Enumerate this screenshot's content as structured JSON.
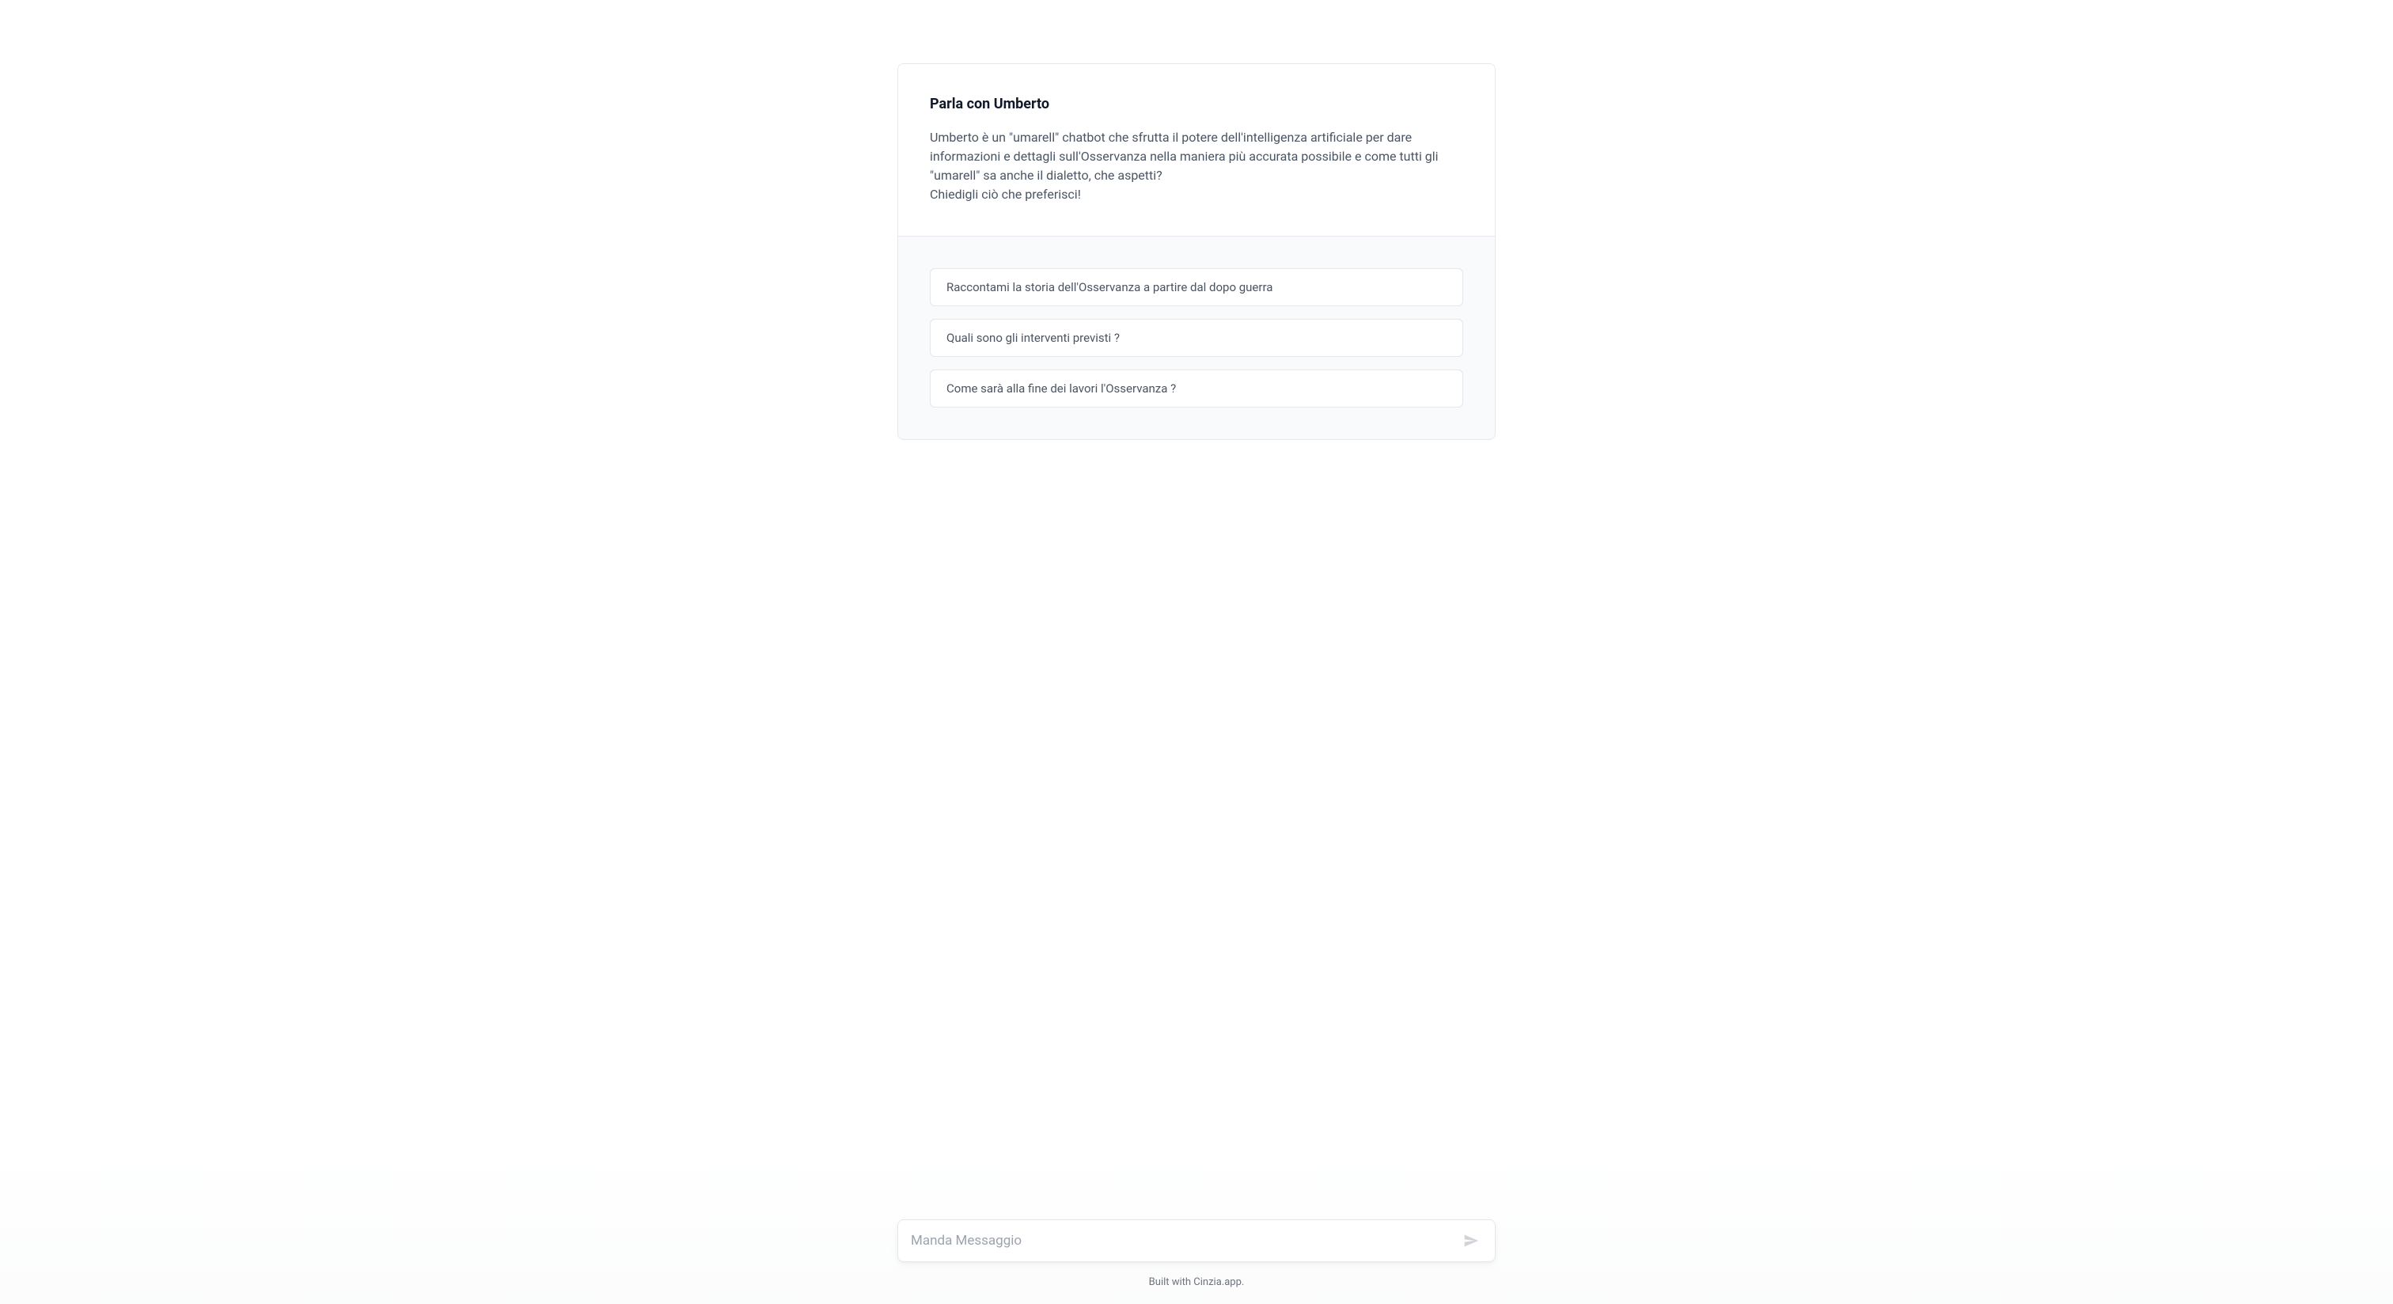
{
  "header": {
    "title": "Parla con Umberto",
    "description_line1": "Umberto è un \"umarell\" chatbot che sfrutta il potere dell'intelligenza artificiale per dare informazioni e dettagli sull'Osservanza nella maniera più accurata possibile e come tutti gli \"umarell\" sa anche il dialetto, che aspetti?",
    "description_line2": "Chiedigli ciò che preferisci!"
  },
  "suggestions": [
    "Raccontami la storia dell'Osservanza a partire dal dopo guerra",
    "Quali sono gli interventi previsti ?",
    "Come sarà alla fine dei lavori l'Osservanza ?"
  ],
  "input": {
    "placeholder": "Manda Messaggio",
    "value": ""
  },
  "footer": {
    "text": "Built with Cinzia.app."
  }
}
